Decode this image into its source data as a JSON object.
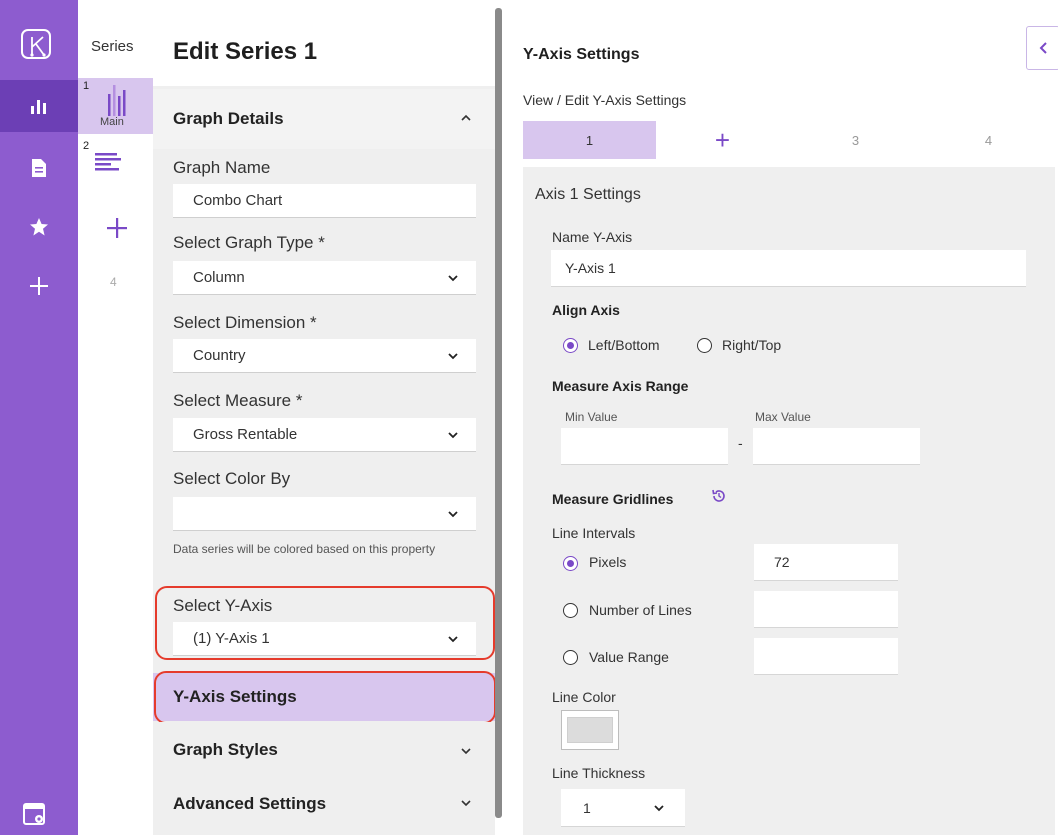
{
  "series_panel": {
    "heading": "Series",
    "items": [
      {
        "number": "1",
        "caption": "Main"
      },
      {
        "number": "2",
        "caption": ""
      }
    ],
    "next_number": "4"
  },
  "edit_panel": {
    "title": "Edit Series 1",
    "graph_details_label": "Graph Details",
    "graph_name_label": "Graph Name",
    "graph_name_value": "Combo Chart",
    "graph_type_label": "Select Graph Type *",
    "graph_type_value": "Column",
    "dimension_label": "Select Dimension *",
    "dimension_value": "Country",
    "measure_label": "Select Measure *",
    "measure_value": "Gross Rentable",
    "color_by_label": "Select Color By",
    "color_by_value": "",
    "color_by_helper": "Data series will be colored based on this property",
    "y_axis_label": "Select Y-Axis",
    "y_axis_value": "(1) Y-Axis 1",
    "y_axis_settings_label": "Y-Axis Settings",
    "graph_styles_label": "Graph Styles",
    "advanced_settings_label": "Advanced Settings"
  },
  "right_panel": {
    "title": "Y-Axis Settings",
    "subtitle": "View / Edit Y-Axis Settings",
    "tabs": [
      "1",
      "+",
      "3",
      "4"
    ],
    "axis_card_title": "Axis 1 Settings",
    "name_label": "Name Y-Axis",
    "name_value": "Y-Axis 1",
    "align_label": "Align Axis",
    "align_left": "Left/Bottom",
    "align_right": "Right/Top",
    "range_label": "Measure Axis Range",
    "min_label": "Min Value",
    "max_label": "Max Value",
    "range_sep": "-",
    "min_value": "",
    "max_value": "",
    "gridlines_label": "Measure Gridlines",
    "intervals_label": "Line Intervals",
    "opt_pixels": "Pixels",
    "opt_pixels_value": "72",
    "opt_lines": "Number of Lines",
    "opt_lines_value": "",
    "opt_range": "Value Range",
    "opt_range_value": "",
    "line_color_label": "Line Color",
    "line_thickness_label": "Line Thickness",
    "line_thickness_value": "1"
  },
  "colors": {
    "rail": "#8d5ccf",
    "rail_active": "#6c3fb5",
    "accent": "#7a49c7",
    "highlight": "#d8c6ee",
    "callout": "#e53b2c"
  }
}
